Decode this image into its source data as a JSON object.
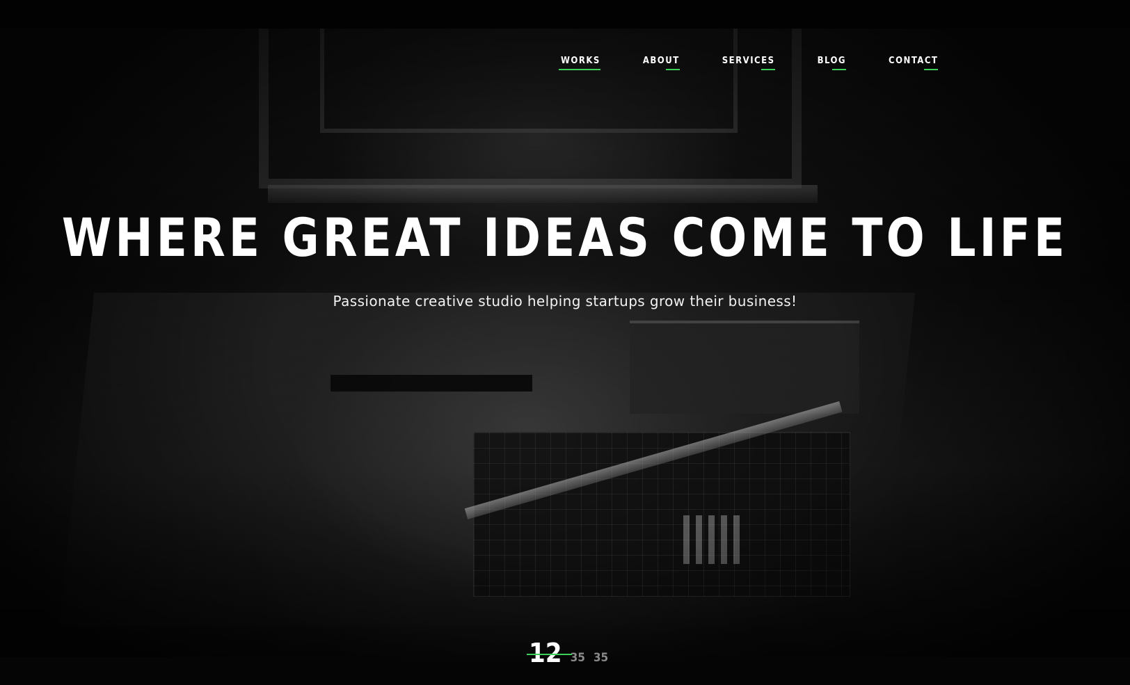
{
  "nav": {
    "items": [
      {
        "label": "WORKS",
        "active": true
      },
      {
        "label": "ABOUT",
        "active": false
      },
      {
        "label": "SERVICES",
        "active": false
      },
      {
        "label": "BLOG",
        "active": false
      },
      {
        "label": "CONTACT",
        "active": false
      }
    ]
  },
  "hero": {
    "title": "WHERE GREAT IDEAS COME TO LIFE",
    "subtitle": "Passionate creative studio helping startups grow their business!"
  },
  "counter": {
    "current": "12",
    "others": [
      "35",
      "35"
    ]
  },
  "colors": {
    "accent": "#3ed15a",
    "background": "#000000",
    "text": "#ffffff"
  }
}
